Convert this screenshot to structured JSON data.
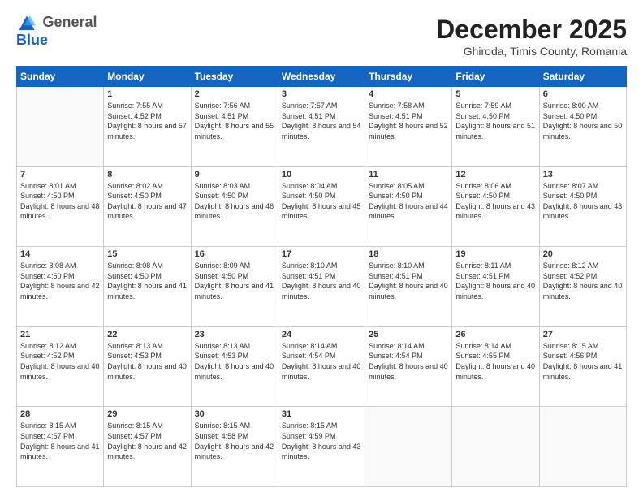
{
  "header": {
    "logo_line1": "General",
    "logo_line2": "Blue",
    "month_year": "December 2025",
    "location": "Ghiroda, Timis County, Romania"
  },
  "days_of_week": [
    "Sunday",
    "Monday",
    "Tuesday",
    "Wednesday",
    "Thursday",
    "Friday",
    "Saturday"
  ],
  "weeks": [
    [
      {
        "day": "",
        "sunrise": "",
        "sunset": "",
        "daylight": ""
      },
      {
        "day": "1",
        "sunrise": "Sunrise: 7:55 AM",
        "sunset": "Sunset: 4:52 PM",
        "daylight": "Daylight: 8 hours and 57 minutes."
      },
      {
        "day": "2",
        "sunrise": "Sunrise: 7:56 AM",
        "sunset": "Sunset: 4:51 PM",
        "daylight": "Daylight: 8 hours and 55 minutes."
      },
      {
        "day": "3",
        "sunrise": "Sunrise: 7:57 AM",
        "sunset": "Sunset: 4:51 PM",
        "daylight": "Daylight: 8 hours and 54 minutes."
      },
      {
        "day": "4",
        "sunrise": "Sunrise: 7:58 AM",
        "sunset": "Sunset: 4:51 PM",
        "daylight": "Daylight: 8 hours and 52 minutes."
      },
      {
        "day": "5",
        "sunrise": "Sunrise: 7:59 AM",
        "sunset": "Sunset: 4:50 PM",
        "daylight": "Daylight: 8 hours and 51 minutes."
      },
      {
        "day": "6",
        "sunrise": "Sunrise: 8:00 AM",
        "sunset": "Sunset: 4:50 PM",
        "daylight": "Daylight: 8 hours and 50 minutes."
      }
    ],
    [
      {
        "day": "7",
        "sunrise": "Sunrise: 8:01 AM",
        "sunset": "Sunset: 4:50 PM",
        "daylight": "Daylight: 8 hours and 48 minutes."
      },
      {
        "day": "8",
        "sunrise": "Sunrise: 8:02 AM",
        "sunset": "Sunset: 4:50 PM",
        "daylight": "Daylight: 8 hours and 47 minutes."
      },
      {
        "day": "9",
        "sunrise": "Sunrise: 8:03 AM",
        "sunset": "Sunset: 4:50 PM",
        "daylight": "Daylight: 8 hours and 46 minutes."
      },
      {
        "day": "10",
        "sunrise": "Sunrise: 8:04 AM",
        "sunset": "Sunset: 4:50 PM",
        "daylight": "Daylight: 8 hours and 45 minutes."
      },
      {
        "day": "11",
        "sunrise": "Sunrise: 8:05 AM",
        "sunset": "Sunset: 4:50 PM",
        "daylight": "Daylight: 8 hours and 44 minutes."
      },
      {
        "day": "12",
        "sunrise": "Sunrise: 8:06 AM",
        "sunset": "Sunset: 4:50 PM",
        "daylight": "Daylight: 8 hours and 43 minutes."
      },
      {
        "day": "13",
        "sunrise": "Sunrise: 8:07 AM",
        "sunset": "Sunset: 4:50 PM",
        "daylight": "Daylight: 8 hours and 43 minutes."
      }
    ],
    [
      {
        "day": "14",
        "sunrise": "Sunrise: 8:08 AM",
        "sunset": "Sunset: 4:50 PM",
        "daylight": "Daylight: 8 hours and 42 minutes."
      },
      {
        "day": "15",
        "sunrise": "Sunrise: 8:08 AM",
        "sunset": "Sunset: 4:50 PM",
        "daylight": "Daylight: 8 hours and 41 minutes."
      },
      {
        "day": "16",
        "sunrise": "Sunrise: 8:09 AM",
        "sunset": "Sunset: 4:50 PM",
        "daylight": "Daylight: 8 hours and 41 minutes."
      },
      {
        "day": "17",
        "sunrise": "Sunrise: 8:10 AM",
        "sunset": "Sunset: 4:51 PM",
        "daylight": "Daylight: 8 hours and 40 minutes."
      },
      {
        "day": "18",
        "sunrise": "Sunrise: 8:10 AM",
        "sunset": "Sunset: 4:51 PM",
        "daylight": "Daylight: 8 hours and 40 minutes."
      },
      {
        "day": "19",
        "sunrise": "Sunrise: 8:11 AM",
        "sunset": "Sunset: 4:51 PM",
        "daylight": "Daylight: 8 hours and 40 minutes."
      },
      {
        "day": "20",
        "sunrise": "Sunrise: 8:12 AM",
        "sunset": "Sunset: 4:52 PM",
        "daylight": "Daylight: 8 hours and 40 minutes."
      }
    ],
    [
      {
        "day": "21",
        "sunrise": "Sunrise: 8:12 AM",
        "sunset": "Sunset: 4:52 PM",
        "daylight": "Daylight: 8 hours and 40 minutes."
      },
      {
        "day": "22",
        "sunrise": "Sunrise: 8:13 AM",
        "sunset": "Sunset: 4:53 PM",
        "daylight": "Daylight: 8 hours and 40 minutes."
      },
      {
        "day": "23",
        "sunrise": "Sunrise: 8:13 AM",
        "sunset": "Sunset: 4:53 PM",
        "daylight": "Daylight: 8 hours and 40 minutes."
      },
      {
        "day": "24",
        "sunrise": "Sunrise: 8:14 AM",
        "sunset": "Sunset: 4:54 PM",
        "daylight": "Daylight: 8 hours and 40 minutes."
      },
      {
        "day": "25",
        "sunrise": "Sunrise: 8:14 AM",
        "sunset": "Sunset: 4:54 PM",
        "daylight": "Daylight: 8 hours and 40 minutes."
      },
      {
        "day": "26",
        "sunrise": "Sunrise: 8:14 AM",
        "sunset": "Sunset: 4:55 PM",
        "daylight": "Daylight: 8 hours and 40 minutes."
      },
      {
        "day": "27",
        "sunrise": "Sunrise: 8:15 AM",
        "sunset": "Sunset: 4:56 PM",
        "daylight": "Daylight: 8 hours and 41 minutes."
      }
    ],
    [
      {
        "day": "28",
        "sunrise": "Sunrise: 8:15 AM",
        "sunset": "Sunset: 4:57 PM",
        "daylight": "Daylight: 8 hours and 41 minutes."
      },
      {
        "day": "29",
        "sunrise": "Sunrise: 8:15 AM",
        "sunset": "Sunset: 4:57 PM",
        "daylight": "Daylight: 8 hours and 42 minutes."
      },
      {
        "day": "30",
        "sunrise": "Sunrise: 8:15 AM",
        "sunset": "Sunset: 4:58 PM",
        "daylight": "Daylight: 8 hours and 42 minutes."
      },
      {
        "day": "31",
        "sunrise": "Sunrise: 8:15 AM",
        "sunset": "Sunset: 4:59 PM",
        "daylight": "Daylight: 8 hours and 43 minutes."
      },
      {
        "day": "",
        "sunrise": "",
        "sunset": "",
        "daylight": ""
      },
      {
        "day": "",
        "sunrise": "",
        "sunset": "",
        "daylight": ""
      },
      {
        "day": "",
        "sunrise": "",
        "sunset": "",
        "daylight": ""
      }
    ]
  ]
}
